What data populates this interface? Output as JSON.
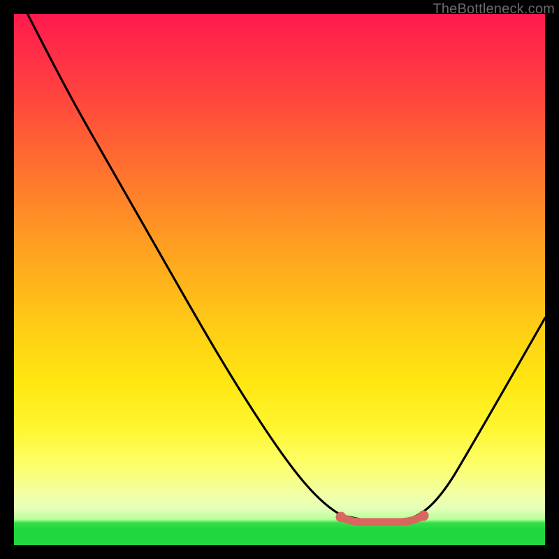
{
  "watermark": "TheBottleneck.com",
  "chart_data": {
    "type": "line",
    "title": "",
    "xlabel": "",
    "ylabel": "",
    "xlim": [
      0,
      100
    ],
    "ylim": [
      0,
      100
    ],
    "grid": false,
    "series": [
      {
        "name": "bottleneck-curve",
        "color": "#000000",
        "x": [
          0,
          6,
          12,
          18,
          24,
          30,
          36,
          42,
          48,
          54,
          60,
          63,
          66,
          69,
          72,
          75,
          78,
          84,
          90,
          96,
          100
        ],
        "values": [
          105,
          96,
          86,
          76,
          66,
          56,
          46,
          36,
          27,
          18,
          10,
          7,
          5,
          4,
          4,
          4,
          6,
          14,
          26,
          42,
          54
        ]
      }
    ],
    "markers": [
      {
        "name": "flat-min-left",
        "x": 63,
        "y": 6,
        "color": "#d9665f"
      },
      {
        "name": "flat-min-right",
        "x": 77,
        "y": 6,
        "color": "#d9665f"
      }
    ],
    "flat_segment": {
      "x0": 63,
      "x1": 77,
      "y": 5,
      "color": "#d9665f"
    },
    "background_gradient": {
      "top": "#ff1a4d",
      "mid": "#ffd514",
      "bottom": "#22d840"
    }
  }
}
